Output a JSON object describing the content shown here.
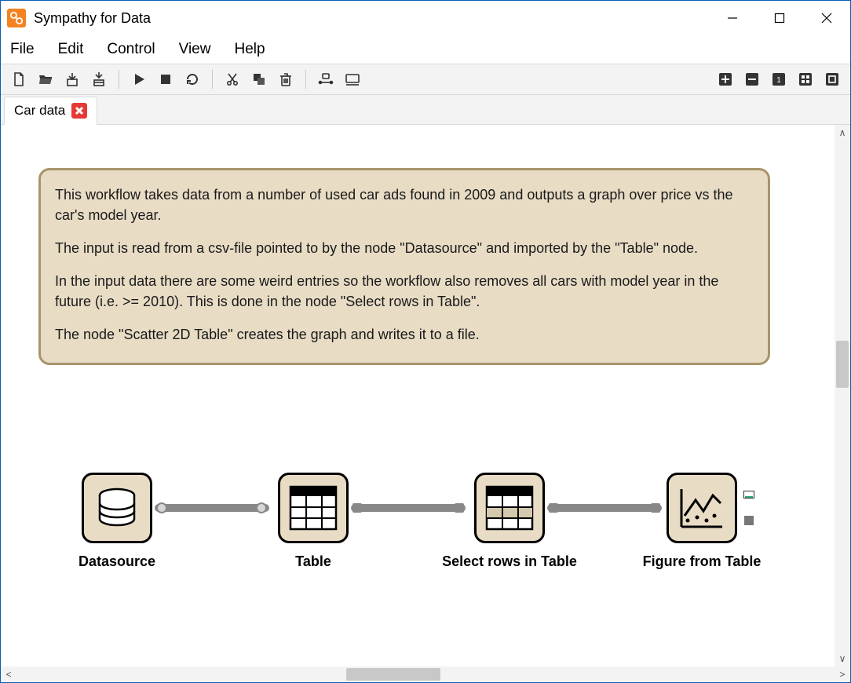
{
  "titlebar": {
    "title": "Sympathy for Data"
  },
  "menu": {
    "items": [
      "File",
      "Edit",
      "Control",
      "View",
      "Help"
    ]
  },
  "toolbar_left": [
    "new-file-icon",
    "open-file-icon",
    "save-icon",
    "save-all-icon",
    "sep",
    "play-icon",
    "stop-icon",
    "reload-icon",
    "sep",
    "cut-icon",
    "copy-icon",
    "delete-icon",
    "sep",
    "insert-node-icon",
    "insert-text-icon"
  ],
  "toolbar_right": [
    "zoom-in-icon",
    "zoom-out-icon",
    "zoom-reset-icon",
    "zoom-fit-icon",
    "fullscreen-icon"
  ],
  "tab": {
    "label": "Car data"
  },
  "note": {
    "p1": "This workflow takes data from a number of used car ads found in 2009 and outputs a graph over price vs the car's model year.",
    "p2": "The input is read from a csv-file pointed to by the node \"Datasource\" and imported by the \"Table\" node.",
    "p3": "In the input data there are some weird entries so the workflow also removes all cars with model year in the future (i.e. >= 2010). This is done in the node \"Select rows in Table\".",
    "p4": "The node \"Scatter 2D Table\" creates the graph and writes it to a file."
  },
  "nodes": {
    "n1": {
      "label": "Datasource"
    },
    "n2": {
      "label": "Table"
    },
    "n3": {
      "label": "Select rows in Table"
    },
    "n4": {
      "label": "Figure from Table"
    }
  }
}
